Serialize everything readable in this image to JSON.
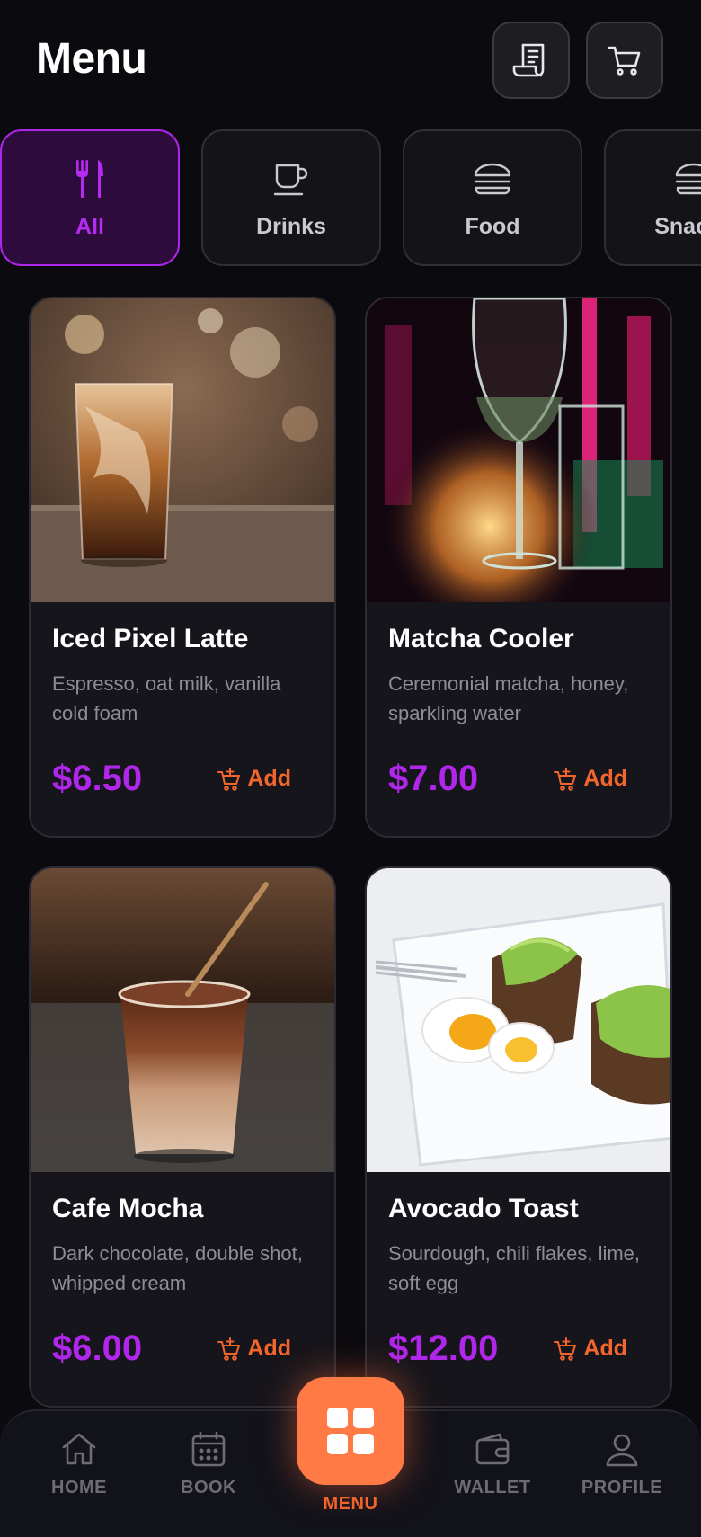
{
  "header": {
    "title": "Menu",
    "receipt_icon": "receipt-icon",
    "cart_icon": "cart-icon"
  },
  "categories": [
    {
      "label": "All",
      "icon": "utensils-icon",
      "active": true
    },
    {
      "label": "Drinks",
      "icon": "cup-icon",
      "active": false
    },
    {
      "label": "Food",
      "icon": "burger-icon",
      "active": false
    },
    {
      "label": "Snacks",
      "icon": "burger-icon",
      "active": false
    }
  ],
  "items": [
    {
      "name": "Iced Pixel Latte",
      "desc": "Espresso, oat milk, vanilla cold foam",
      "price": "$6.50",
      "add_label": "Add"
    },
    {
      "name": "Matcha Cooler",
      "desc": "Ceremonial matcha, honey, sparkling water",
      "price": "$7.00",
      "add_label": "Add"
    },
    {
      "name": "Cafe Mocha",
      "desc": "Dark chocolate, double shot, whipped cream",
      "price": "$6.00",
      "add_label": "Add"
    },
    {
      "name": "Avocado Toast",
      "desc": "Sourdough, chili flakes, lime, soft egg",
      "price": "$12.00",
      "add_label": "Add"
    }
  ],
  "nav": {
    "home": "HOME",
    "book": "BOOK",
    "menu": "MENU",
    "wallet": "WALLET",
    "profile": "PROFILE"
  },
  "colors": {
    "accent_purple": "#b026ea",
    "accent_orange": "#f2652d",
    "fab": "#ff7a45",
    "background": "#0b0a0f"
  }
}
